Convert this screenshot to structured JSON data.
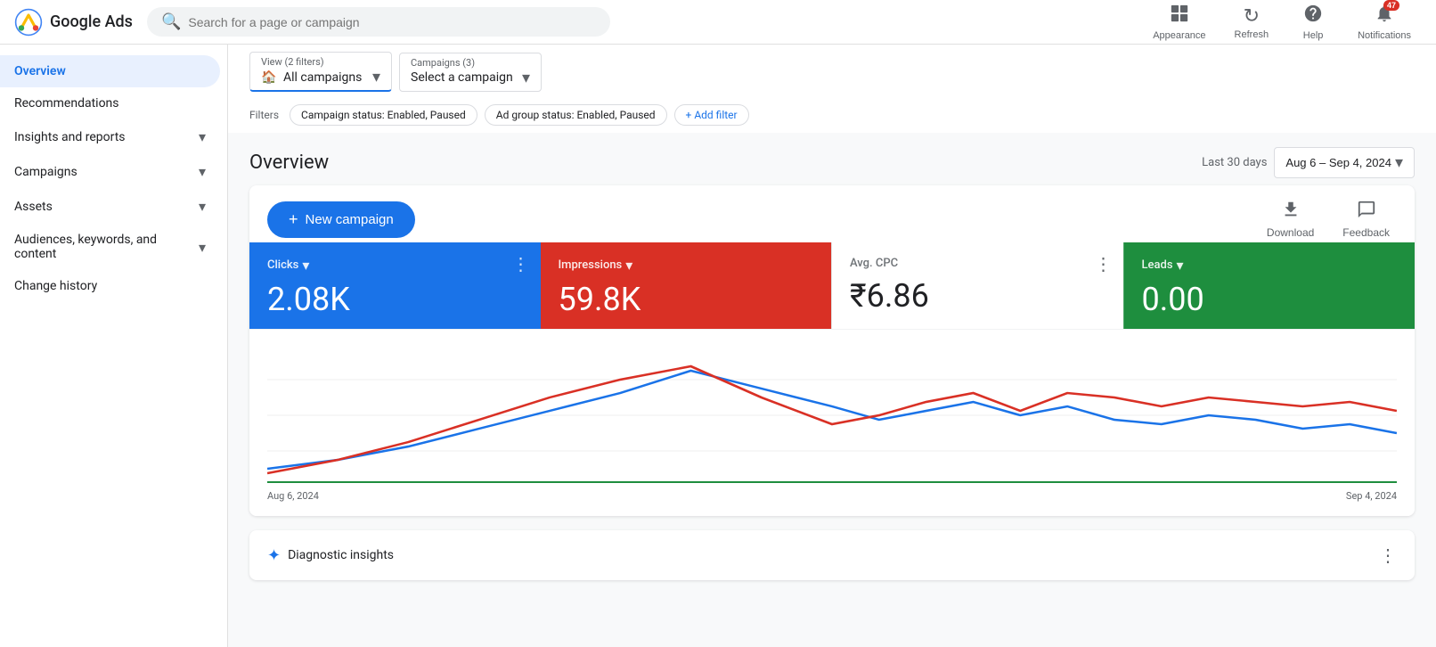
{
  "app": {
    "name": "Google Ads",
    "logo_letter": "G"
  },
  "topnav": {
    "search_placeholder": "Search for a page or campaign",
    "actions": [
      {
        "id": "appearance",
        "label": "Appearance",
        "icon": "▦"
      },
      {
        "id": "refresh",
        "label": "Refresh",
        "icon": "↻"
      },
      {
        "id": "help",
        "label": "Help",
        "icon": "?"
      },
      {
        "id": "notifications",
        "label": "Notifications",
        "icon": "🔔",
        "badge": "47"
      }
    ]
  },
  "sidebar": {
    "items": [
      {
        "id": "overview",
        "label": "Overview",
        "active": true,
        "has_arrow": false
      },
      {
        "id": "recommendations",
        "label": "Recommendations",
        "active": false,
        "has_arrow": false
      },
      {
        "id": "insights",
        "label": "Insights and reports",
        "active": false,
        "has_arrow": true
      },
      {
        "id": "campaigns",
        "label": "Campaigns",
        "active": false,
        "has_arrow": true
      },
      {
        "id": "assets",
        "label": "Assets",
        "active": false,
        "has_arrow": true
      },
      {
        "id": "audiences",
        "label": "Audiences, keywords, and content",
        "active": false,
        "has_arrow": true
      },
      {
        "id": "change-history",
        "label": "Change history",
        "active": false,
        "has_arrow": false
      }
    ]
  },
  "filters": {
    "label": "Filters",
    "view_label": "View (2 filters)",
    "all_campaigns_label": "All campaigns",
    "campaigns_count_label": "Campaigns (3)",
    "select_campaign_label": "Select a campaign",
    "chips": [
      {
        "id": "campaign-status",
        "label": "Campaign status: Enabled, Paused"
      },
      {
        "id": "adgroup-status",
        "label": "Ad group status: Enabled, Paused"
      }
    ],
    "add_filter_label": "+ Add filter"
  },
  "overview": {
    "title": "Overview",
    "date_range_prefix": "Last 30 days",
    "date_range_value": "Aug 6 – Sep 4, 2024"
  },
  "new_campaign": {
    "label": "New campaign"
  },
  "actions": {
    "download": "Download",
    "feedback": "Feedback"
  },
  "metrics": [
    {
      "id": "clicks",
      "label": "Clicks",
      "value": "2.08K",
      "color": "blue",
      "has_arrow": true
    },
    {
      "id": "impressions",
      "label": "Impressions",
      "value": "59.8K",
      "color": "red",
      "has_arrow": true
    },
    {
      "id": "avg_cpc",
      "label": "Avg. CPC",
      "value": "₹6.86",
      "color": "white",
      "has_arrow": false
    },
    {
      "id": "leads",
      "label": "Leads",
      "value": "0.00",
      "color": "green",
      "has_arrow": true
    }
  ],
  "chart": {
    "start_date": "Aug 6, 2024",
    "end_date": "Sep 4, 2024",
    "colors": {
      "blue_line": "#1a73e8",
      "red_line": "#d93025",
      "green_line": "#1e8e3e"
    }
  },
  "diagnostic": {
    "label": "Diagnostic insights"
  }
}
